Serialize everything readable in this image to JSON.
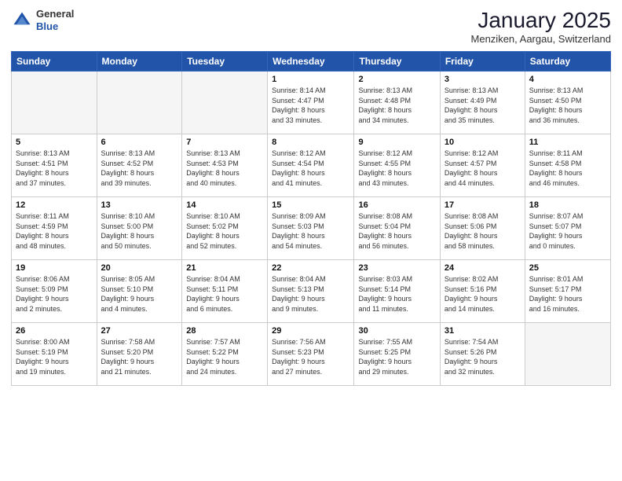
{
  "header": {
    "logo_general": "General",
    "logo_blue": "Blue",
    "month_title": "January 2025",
    "location": "Menziken, Aargau, Switzerland"
  },
  "weekdays": [
    "Sunday",
    "Monday",
    "Tuesday",
    "Wednesday",
    "Thursday",
    "Friday",
    "Saturday"
  ],
  "weeks": [
    [
      {
        "day": "",
        "info": ""
      },
      {
        "day": "",
        "info": ""
      },
      {
        "day": "",
        "info": ""
      },
      {
        "day": "1",
        "info": "Sunrise: 8:14 AM\nSunset: 4:47 PM\nDaylight: 8 hours\nand 33 minutes."
      },
      {
        "day": "2",
        "info": "Sunrise: 8:13 AM\nSunset: 4:48 PM\nDaylight: 8 hours\nand 34 minutes."
      },
      {
        "day": "3",
        "info": "Sunrise: 8:13 AM\nSunset: 4:49 PM\nDaylight: 8 hours\nand 35 minutes."
      },
      {
        "day": "4",
        "info": "Sunrise: 8:13 AM\nSunset: 4:50 PM\nDaylight: 8 hours\nand 36 minutes."
      }
    ],
    [
      {
        "day": "5",
        "info": "Sunrise: 8:13 AM\nSunset: 4:51 PM\nDaylight: 8 hours\nand 37 minutes."
      },
      {
        "day": "6",
        "info": "Sunrise: 8:13 AM\nSunset: 4:52 PM\nDaylight: 8 hours\nand 39 minutes."
      },
      {
        "day": "7",
        "info": "Sunrise: 8:13 AM\nSunset: 4:53 PM\nDaylight: 8 hours\nand 40 minutes."
      },
      {
        "day": "8",
        "info": "Sunrise: 8:12 AM\nSunset: 4:54 PM\nDaylight: 8 hours\nand 41 minutes."
      },
      {
        "day": "9",
        "info": "Sunrise: 8:12 AM\nSunset: 4:55 PM\nDaylight: 8 hours\nand 43 minutes."
      },
      {
        "day": "10",
        "info": "Sunrise: 8:12 AM\nSunset: 4:57 PM\nDaylight: 8 hours\nand 44 minutes."
      },
      {
        "day": "11",
        "info": "Sunrise: 8:11 AM\nSunset: 4:58 PM\nDaylight: 8 hours\nand 46 minutes."
      }
    ],
    [
      {
        "day": "12",
        "info": "Sunrise: 8:11 AM\nSunset: 4:59 PM\nDaylight: 8 hours\nand 48 minutes."
      },
      {
        "day": "13",
        "info": "Sunrise: 8:10 AM\nSunset: 5:00 PM\nDaylight: 8 hours\nand 50 minutes."
      },
      {
        "day": "14",
        "info": "Sunrise: 8:10 AM\nSunset: 5:02 PM\nDaylight: 8 hours\nand 52 minutes."
      },
      {
        "day": "15",
        "info": "Sunrise: 8:09 AM\nSunset: 5:03 PM\nDaylight: 8 hours\nand 54 minutes."
      },
      {
        "day": "16",
        "info": "Sunrise: 8:08 AM\nSunset: 5:04 PM\nDaylight: 8 hours\nand 56 minutes."
      },
      {
        "day": "17",
        "info": "Sunrise: 8:08 AM\nSunset: 5:06 PM\nDaylight: 8 hours\nand 58 minutes."
      },
      {
        "day": "18",
        "info": "Sunrise: 8:07 AM\nSunset: 5:07 PM\nDaylight: 9 hours\nand 0 minutes."
      }
    ],
    [
      {
        "day": "19",
        "info": "Sunrise: 8:06 AM\nSunset: 5:09 PM\nDaylight: 9 hours\nand 2 minutes."
      },
      {
        "day": "20",
        "info": "Sunrise: 8:05 AM\nSunset: 5:10 PM\nDaylight: 9 hours\nand 4 minutes."
      },
      {
        "day": "21",
        "info": "Sunrise: 8:04 AM\nSunset: 5:11 PM\nDaylight: 9 hours\nand 6 minutes."
      },
      {
        "day": "22",
        "info": "Sunrise: 8:04 AM\nSunset: 5:13 PM\nDaylight: 9 hours\nand 9 minutes."
      },
      {
        "day": "23",
        "info": "Sunrise: 8:03 AM\nSunset: 5:14 PM\nDaylight: 9 hours\nand 11 minutes."
      },
      {
        "day": "24",
        "info": "Sunrise: 8:02 AM\nSunset: 5:16 PM\nDaylight: 9 hours\nand 14 minutes."
      },
      {
        "day": "25",
        "info": "Sunrise: 8:01 AM\nSunset: 5:17 PM\nDaylight: 9 hours\nand 16 minutes."
      }
    ],
    [
      {
        "day": "26",
        "info": "Sunrise: 8:00 AM\nSunset: 5:19 PM\nDaylight: 9 hours\nand 19 minutes."
      },
      {
        "day": "27",
        "info": "Sunrise: 7:58 AM\nSunset: 5:20 PM\nDaylight: 9 hours\nand 21 minutes."
      },
      {
        "day": "28",
        "info": "Sunrise: 7:57 AM\nSunset: 5:22 PM\nDaylight: 9 hours\nand 24 minutes."
      },
      {
        "day": "29",
        "info": "Sunrise: 7:56 AM\nSunset: 5:23 PM\nDaylight: 9 hours\nand 27 minutes."
      },
      {
        "day": "30",
        "info": "Sunrise: 7:55 AM\nSunset: 5:25 PM\nDaylight: 9 hours\nand 29 minutes."
      },
      {
        "day": "31",
        "info": "Sunrise: 7:54 AM\nSunset: 5:26 PM\nDaylight: 9 hours\nand 32 minutes."
      },
      {
        "day": "",
        "info": ""
      }
    ]
  ]
}
